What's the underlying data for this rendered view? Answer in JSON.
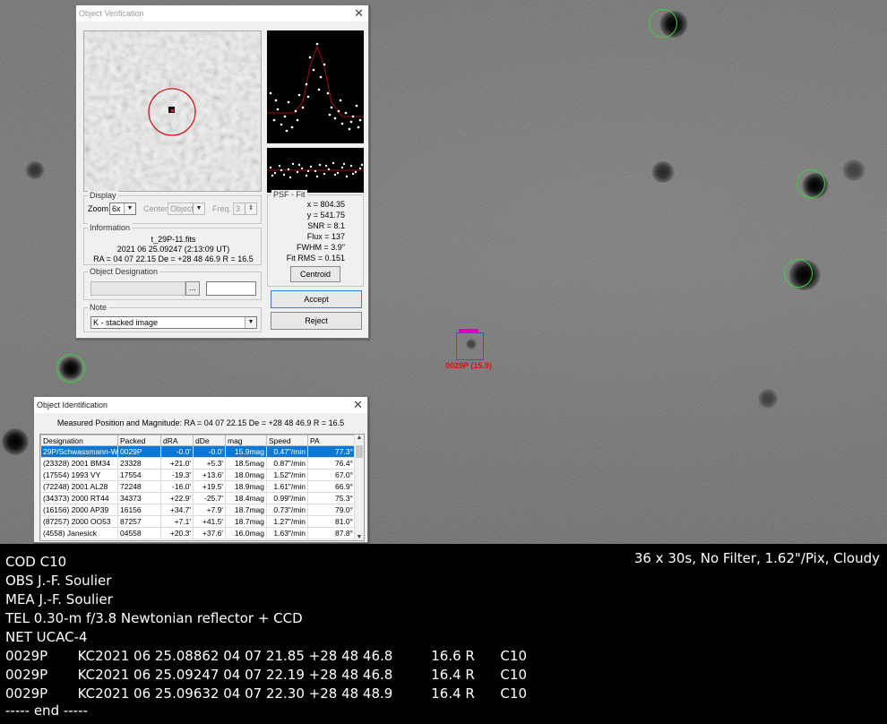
{
  "target": {
    "label": "0029P (15.9)"
  },
  "verification": {
    "title": "Object Verification",
    "display": {
      "group": "Display",
      "zoom_label": "Zoom",
      "zoom_value": "6x",
      "center_label": "Center",
      "center_value": "Object",
      "freq_label": "Freq.",
      "freq_value": "3"
    },
    "information": {
      "group": "Information",
      "file": "t_29P-11.fits",
      "time": "2021 06 25.09247 (2:13:09 UT)",
      "position": "RA = 04 07 22.15   De = +28 48 46.9   R = 16.5"
    },
    "designation": {
      "group": "Object Designation",
      "browse": "...",
      "value": "",
      "extra": ""
    },
    "note": {
      "group": "Note",
      "value": "K - stacked image"
    },
    "psf": {
      "group": "PSF - Fit",
      "lines": [
        "x = 804.35",
        "y = 541.75",
        "SNR = 8.1",
        "Flux = 137",
        "FWHM = 3.9\"",
        "Fit RMS = 0.151"
      ],
      "centroid": "Centroid"
    },
    "accept": "Accept",
    "reject": "Reject"
  },
  "identification": {
    "title": "Object Identification",
    "measured": "Measured Position and Magnitude: RA = 04 07 22.15   De = +28 48 46.9   R = 16.5",
    "columns": [
      "Designation",
      "Packed",
      "dRA",
      "dDe",
      "mag",
      "Speed",
      "PA"
    ],
    "rows": [
      [
        "29P/Schwassmann-W",
        "0029P",
        "-0.0'",
        "-0.0'",
        "15.9mag",
        "0.47\"/min",
        "77.3°"
      ],
      [
        "(23328) 2001 BM34",
        "23328",
        "+21.0'",
        "+5.3'",
        "18.5mag",
        "0.87\"/min",
        "76.4°"
      ],
      [
        "(17554) 1993 VY",
        "17554",
        "-19.3'",
        "+13.6'",
        "18.0mag",
        "1.52\"/min",
        "67.0°"
      ],
      [
        "(72248) 2001 AL28",
        "72248",
        "-16.0'",
        "+19.5'",
        "18.9mag",
        "1.61\"/min",
        "66.9°"
      ],
      [
        "(34373) 2000 RT44",
        "34373",
        "+22.9'",
        "-25.7'",
        "18.4mag",
        "0.99\"/min",
        "75.3°"
      ],
      [
        "(16156) 2000 AP39",
        "16156",
        "+34.7'",
        "+7.9'",
        "18.7mag",
        "0.73\"/min",
        "79.0°"
      ],
      [
        "(87257) 2000 OO53",
        "87257",
        "+7.1'",
        "+41.5'",
        "18.7mag",
        "1.27\"/min",
        "81.0°"
      ],
      [
        "(4558) Janesick",
        "04558",
        "+20.3'",
        "+37.6'",
        "16.0mag",
        "1.63\"/min",
        "87.8°"
      ]
    ]
  },
  "report": {
    "obs_info": "36 x 30s, No Filter, 1.62\"/Pix, Cloudy",
    "lines": [
      "COD C10",
      "OBS J.-F. Soulier",
      "MEA J.-F. Soulier",
      "TEL 0.30-m f/3.8 Newtonian reflector + CCD",
      "NET UCAC-4",
      "0029P       KC2021 06 25.08862 04 07 21.85 +28 48 46.8         16.6 R      C10",
      "0029P       KC2021 06 25.09247 04 07 22.19 +28 48 46.8         16.4 R      C10",
      "0029P       KC2021 06 25.09632 04 07 22.30 +28 48 48.9         16.4 R      C10",
      "----- end -----"
    ]
  }
}
